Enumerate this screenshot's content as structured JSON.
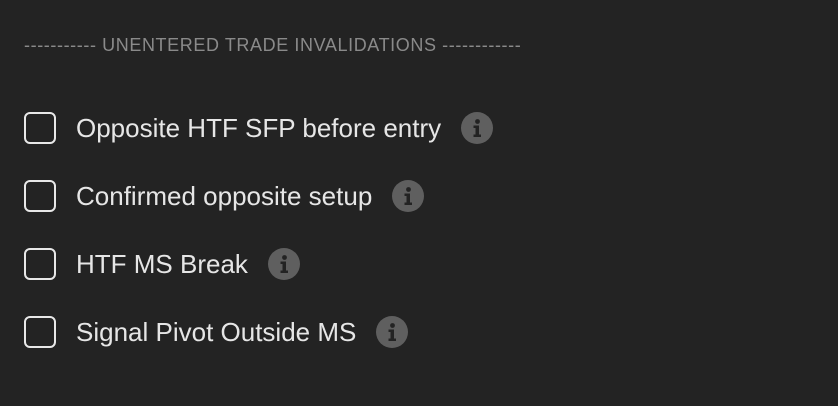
{
  "section": {
    "header": "----------- UNENTERED TRADE INVALIDATIONS ------------"
  },
  "options": [
    {
      "label": "Opposite HTF SFP before entry",
      "checked": false,
      "icon": "info-icon"
    },
    {
      "label": "Confirmed opposite setup",
      "checked": false,
      "icon": "info-icon"
    },
    {
      "label": "HTF MS Break",
      "checked": false,
      "icon": "info-icon"
    },
    {
      "label": "Signal Pivot Outside MS",
      "checked": false,
      "icon": "info-icon"
    }
  ],
  "colors": {
    "background": "#232323",
    "header_text": "#8a8a8a",
    "label_text": "#e6e6e6",
    "checkbox_border": "#e8e8e8",
    "info_icon_bg": "#5f5f5f",
    "info_icon_glyph": "#232323"
  }
}
